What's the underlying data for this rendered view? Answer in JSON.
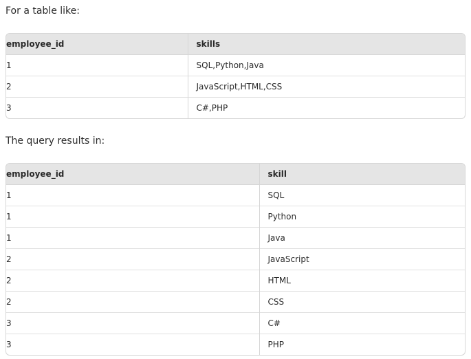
{
  "intro_text": "For a table like:",
  "outro_text": "The query results in:",
  "input_table": {
    "headers": [
      "employee_id",
      "skills"
    ],
    "rows": [
      [
        "1",
        "SQL,Python,Java"
      ],
      [
        "2",
        "JavaScript,HTML,CSS"
      ],
      [
        "3",
        "C#,PHP"
      ]
    ]
  },
  "output_table": {
    "headers": [
      "employee_id",
      "skill"
    ],
    "rows": [
      [
        "1",
        "SQL"
      ],
      [
        "1",
        "Python"
      ],
      [
        "1",
        "Java"
      ],
      [
        "2",
        "JavaScript"
      ],
      [
        "2",
        "HTML"
      ],
      [
        "2",
        "CSS"
      ],
      [
        "3",
        "C#"
      ],
      [
        "3",
        "PHP"
      ]
    ]
  }
}
